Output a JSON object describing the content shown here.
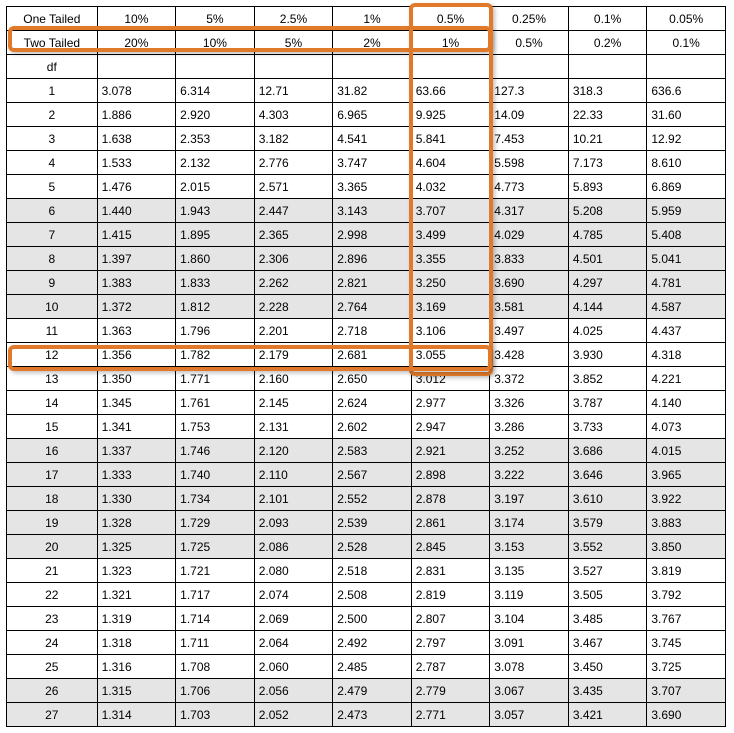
{
  "headers": {
    "one_tailed_label": "One Tailed",
    "two_tailed_label": "Two Tailed",
    "df_label": "df",
    "one_tailed": [
      "10%",
      "5%",
      "2.5%",
      "1%",
      "0.5%",
      "0.25%",
      "0.1%",
      "0.05%"
    ],
    "two_tailed": [
      "20%",
      "10%",
      "5%",
      "2%",
      "1%",
      "0.5%",
      "0.2%",
      "0.1%"
    ]
  },
  "rows": [
    {
      "df": "1",
      "v": [
        "3.078",
        "6.314",
        "12.71",
        "31.82",
        "63.66",
        "127.3",
        "318.3",
        "636.6"
      ],
      "shade": false
    },
    {
      "df": "2",
      "v": [
        "1.886",
        "2.920",
        "4.303",
        "6.965",
        "9.925",
        "14.09",
        "22.33",
        "31.60"
      ],
      "shade": false
    },
    {
      "df": "3",
      "v": [
        "1.638",
        "2.353",
        "3.182",
        "4.541",
        "5.841",
        "7.453",
        "10.21",
        "12.92"
      ],
      "shade": false
    },
    {
      "df": "4",
      "v": [
        "1.533",
        "2.132",
        "2.776",
        "3.747",
        "4.604",
        "5.598",
        "7.173",
        "8.610"
      ],
      "shade": false
    },
    {
      "df": "5",
      "v": [
        "1.476",
        "2.015",
        "2.571",
        "3.365",
        "4.032",
        "4.773",
        "5.893",
        "6.869"
      ],
      "shade": false
    },
    {
      "df": "6",
      "v": [
        "1.440",
        "1.943",
        "2.447",
        "3.143",
        "3.707",
        "4.317",
        "5.208",
        "5.959"
      ],
      "shade": true
    },
    {
      "df": "7",
      "v": [
        "1.415",
        "1.895",
        "2.365",
        "2.998",
        "3.499",
        "4.029",
        "4.785",
        "5.408"
      ],
      "shade": true
    },
    {
      "df": "8",
      "v": [
        "1.397",
        "1.860",
        "2.306",
        "2.896",
        "3.355",
        "3.833",
        "4.501",
        "5.041"
      ],
      "shade": true
    },
    {
      "df": "9",
      "v": [
        "1.383",
        "1.833",
        "2.262",
        "2.821",
        "3.250",
        "3.690",
        "4.297",
        "4.781"
      ],
      "shade": true
    },
    {
      "df": "10",
      "v": [
        "1.372",
        "1.812",
        "2.228",
        "2.764",
        "3.169",
        "3.581",
        "4.144",
        "4.587"
      ],
      "shade": true
    },
    {
      "df": "11",
      "v": [
        "1.363",
        "1.796",
        "2.201",
        "2.718",
        "3.106",
        "3.497",
        "4.025",
        "4.437"
      ],
      "shade": false
    },
    {
      "df": "12",
      "v": [
        "1.356",
        "1.782",
        "2.179",
        "2.681",
        "3.055",
        "3.428",
        "3.930",
        "4.318"
      ],
      "shade": false
    },
    {
      "df": "13",
      "v": [
        "1.350",
        "1.771",
        "2.160",
        "2.650",
        "3.012",
        "3.372",
        "3.852",
        "4.221"
      ],
      "shade": false
    },
    {
      "df": "14",
      "v": [
        "1.345",
        "1.761",
        "2.145",
        "2.624",
        "2.977",
        "3.326",
        "3.787",
        "4.140"
      ],
      "shade": false
    },
    {
      "df": "15",
      "v": [
        "1.341",
        "1.753",
        "2.131",
        "2.602",
        "2.947",
        "3.286",
        "3.733",
        "4.073"
      ],
      "shade": false
    },
    {
      "df": "16",
      "v": [
        "1.337",
        "1.746",
        "2.120",
        "2.583",
        "2.921",
        "3.252",
        "3.686",
        "4.015"
      ],
      "shade": true
    },
    {
      "df": "17",
      "v": [
        "1.333",
        "1.740",
        "2.110",
        "2.567",
        "2.898",
        "3.222",
        "3.646",
        "3.965"
      ],
      "shade": true
    },
    {
      "df": "18",
      "v": [
        "1.330",
        "1.734",
        "2.101",
        "2.552",
        "2.878",
        "3.197",
        "3.610",
        "3.922"
      ],
      "shade": true
    },
    {
      "df": "19",
      "v": [
        "1.328",
        "1.729",
        "2.093",
        "2.539",
        "2.861",
        "3.174",
        "3.579",
        "3.883"
      ],
      "shade": true
    },
    {
      "df": "20",
      "v": [
        "1.325",
        "1.725",
        "2.086",
        "2.528",
        "2.845",
        "3.153",
        "3.552",
        "3.850"
      ],
      "shade": true
    },
    {
      "df": "21",
      "v": [
        "1.323",
        "1.721",
        "2.080",
        "2.518",
        "2.831",
        "3.135",
        "3.527",
        "3.819"
      ],
      "shade": false
    },
    {
      "df": "22",
      "v": [
        "1.321",
        "1.717",
        "2.074",
        "2.508",
        "2.819",
        "3.119",
        "3.505",
        "3.792"
      ],
      "shade": false
    },
    {
      "df": "23",
      "v": [
        "1.319",
        "1.714",
        "2.069",
        "2.500",
        "2.807",
        "3.104",
        "3.485",
        "3.767"
      ],
      "shade": false
    },
    {
      "df": "24",
      "v": [
        "1.318",
        "1.711",
        "2.064",
        "2.492",
        "2.797",
        "3.091",
        "3.467",
        "3.745"
      ],
      "shade": false
    },
    {
      "df": "25",
      "v": [
        "1.316",
        "1.708",
        "2.060",
        "2.485",
        "2.787",
        "3.078",
        "3.450",
        "3.725"
      ],
      "shade": false
    },
    {
      "df": "26",
      "v": [
        "1.315",
        "1.706",
        "2.056",
        "2.479",
        "2.779",
        "3.067",
        "3.435",
        "3.707"
      ],
      "shade": true
    },
    {
      "df": "27",
      "v": [
        "1.314",
        "1.703",
        "2.052",
        "2.473",
        "2.771",
        "3.057",
        "3.421",
        "3.690"
      ],
      "shade": true
    }
  ]
}
